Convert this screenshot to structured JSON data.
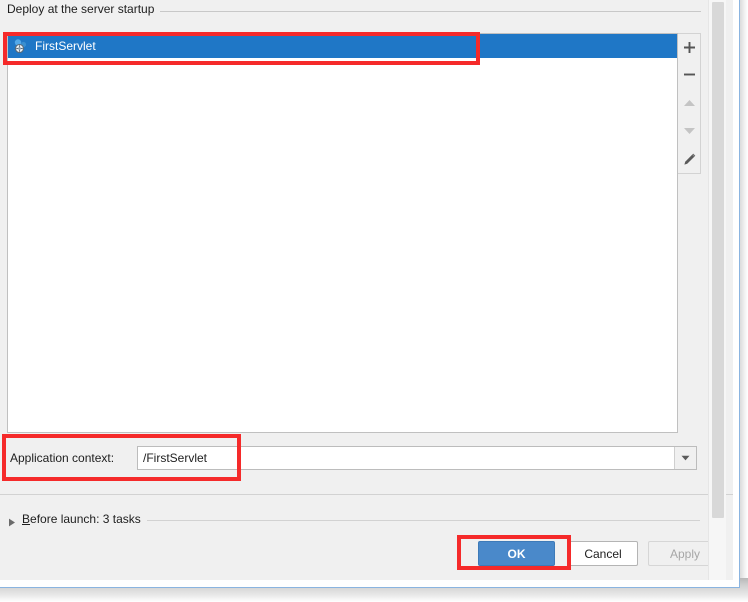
{
  "dialog": {
    "group_title": "Deploy at the server startup",
    "list": {
      "items": [
        {
          "label": "FirstServlet",
          "icon": "artifact-icon",
          "selected": true
        }
      ]
    },
    "list_toolbar": {
      "add": {
        "name": "add-icon",
        "tooltip": "Add",
        "enabled": true
      },
      "remove": {
        "name": "remove-icon",
        "tooltip": "Remove",
        "enabled": true
      },
      "move_up": {
        "name": "arrow-up-icon",
        "tooltip": "Move Up",
        "enabled": false
      },
      "move_down": {
        "name": "arrow-down-icon",
        "tooltip": "Move Down",
        "enabled": false
      },
      "edit": {
        "name": "pencil-icon",
        "tooltip": "Edit",
        "enabled": true
      }
    },
    "application_context": {
      "label": "Application context:",
      "value": "/FirstServlet",
      "placeholder": "",
      "dropdown_icon": "chevron-down-icon"
    },
    "before_launch": {
      "expander_icon": "triangle-right-icon",
      "mnemonic": "B",
      "label_rest": "efore launch: 3 tasks",
      "full_label": "Before launch: 3 tasks"
    },
    "buttons": {
      "ok": {
        "label": "OK",
        "enabled": true,
        "default": true
      },
      "cancel": {
        "label": "Cancel",
        "enabled": true
      },
      "apply": {
        "label": "Apply",
        "enabled": false
      }
    }
  },
  "colors": {
    "selection_blue": "#1f77c6",
    "ok_button_blue": "#4a89ca",
    "annotation_red": "#f52a2a",
    "dialog_background": "#f0f0f0",
    "window_border_blue": "#8ab4e0",
    "disabled_text": "#a6a6a6"
  },
  "annotations": [
    {
      "name": "annotation-list-item",
      "target": "FirstServlet list row"
    },
    {
      "name": "annotation-application-context",
      "target": "Application context field"
    },
    {
      "name": "annotation-ok-button",
      "target": "OK button"
    }
  ]
}
